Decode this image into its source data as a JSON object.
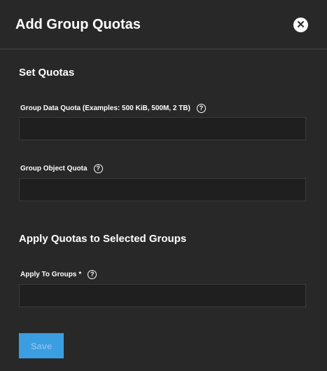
{
  "header": {
    "title": "Add Group Quotas",
    "close_icon": "close-circle-icon"
  },
  "set_quotas": {
    "heading": "Set Quotas",
    "data_quota": {
      "label": "Group Data Quota (Examples: 500 KiB, 500M, 2 TB)",
      "value": "",
      "help": "?"
    },
    "object_quota": {
      "label": "Group Object Quota",
      "value": "",
      "help": "?"
    }
  },
  "apply": {
    "heading": "Apply Quotas to Selected Groups",
    "groups": {
      "label": "Apply To Groups",
      "required": "*",
      "value": "",
      "help": "?"
    }
  },
  "save_label": "Save",
  "colors": {
    "background": "#282828",
    "input": "#1f1f1f",
    "primary": "#3a9ee0"
  }
}
